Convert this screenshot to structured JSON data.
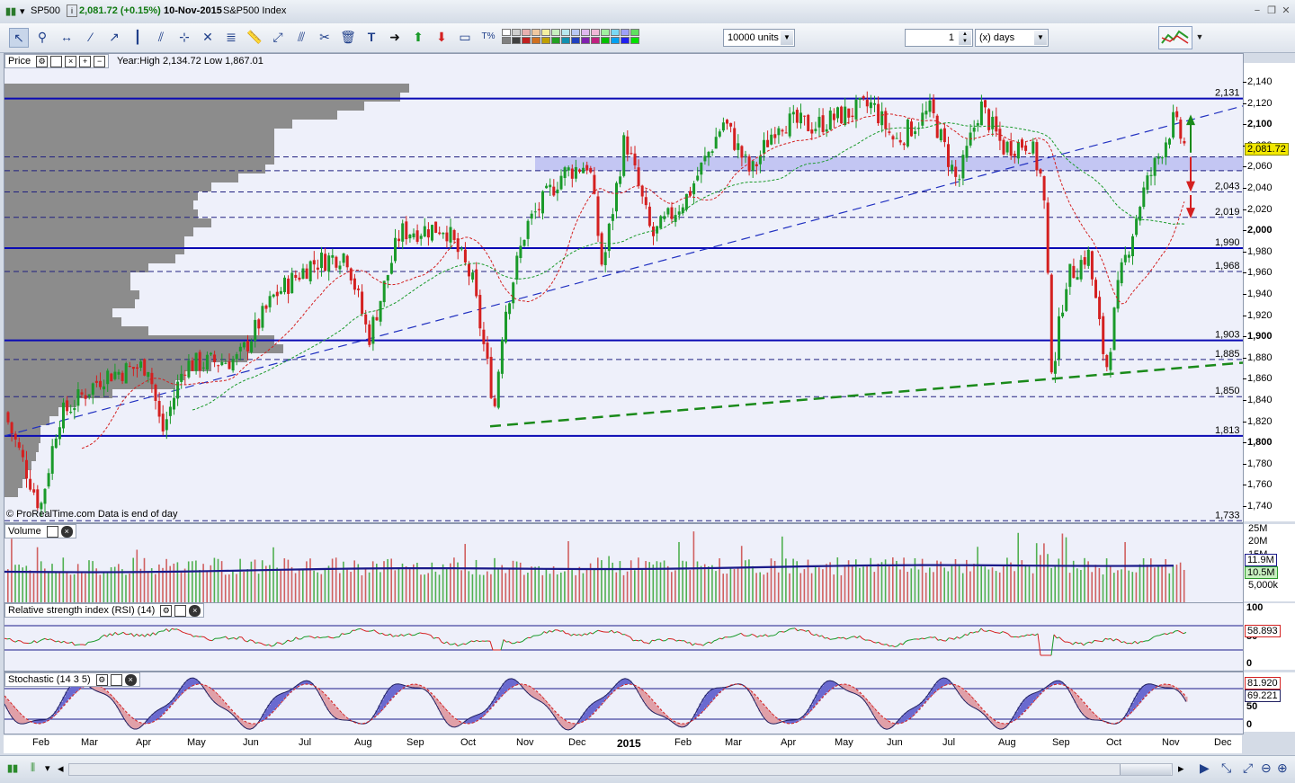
{
  "window": {
    "symbol": "SP500",
    "price_change": "2,081.72 (+0.15%)",
    "date": "10-Nov-2015",
    "name": "S&P500 Index"
  },
  "toolbar": {
    "units": "10000 units",
    "period_value": "1",
    "period_unit": "(x) days",
    "icons": [
      "pointer-icon",
      "zoom-icon",
      "horizontal-line-icon",
      "trendline-icon",
      "ray-icon",
      "vertical-line-icon",
      "channel-icon",
      "crosshair-icon",
      "fan-icon",
      "fibonacci-icon",
      "ruler-icon",
      "arrows-icon",
      "parallel-icon",
      "tools-icon",
      "trash-icon",
      "text-icon",
      "arrow-right-icon",
      "arrow-up-icon",
      "arrow-down-icon",
      "rectangle-icon",
      "percent-icon"
    ]
  },
  "price_panel": {
    "title": "Price",
    "info": "Year:High 2,134.72 Low 1,867.01",
    "footer": "© ProRealTime.com  Data is end of day",
    "last_price": "2,081.72",
    "y_ticks": [
      "2,140",
      "2,120",
      "2,100",
      "2,080",
      "2,060",
      "2,040",
      "2,020",
      "2,000",
      "1,980",
      "1,960",
      "1,940",
      "1,920",
      "1,900",
      "1,880",
      "1,860",
      "1,840",
      "1,820",
      "1,800",
      "1,780",
      "1,760",
      "1,740"
    ],
    "level_labels": [
      "2,131",
      "2,043",
      "2,019",
      "1,990",
      "1,968",
      "1,903",
      "1,885",
      "1,850",
      "1,813",
      "1,733"
    ]
  },
  "volume_panel": {
    "title": "Volume",
    "y_ticks": [
      "25M",
      "20M",
      "15M",
      "10M",
      "5,000k"
    ],
    "value_avg": "11.9M",
    "value_last": "10.5M"
  },
  "rsi_panel": {
    "title": "Relative strength index (RSI) (14)",
    "y_ticks": [
      "100",
      "50",
      "0"
    ],
    "value": "58.893"
  },
  "stoch_panel": {
    "title": "Stochastic (14 3 5)",
    "y_ticks": [
      "50",
      "0"
    ],
    "value_k": "81.920",
    "value_d": "69.221"
  },
  "x_axis": [
    "Feb",
    "Mar",
    "Apr",
    "May",
    "Jun",
    "Jul",
    "Aug",
    "Sep",
    "Oct",
    "Nov",
    "Dec",
    "2015",
    "Feb",
    "Mar",
    "Apr",
    "May",
    "Jun",
    "Jul",
    "Aug",
    "Sep",
    "Oct",
    "Nov",
    "Dec"
  ],
  "colors": {
    "up": "#1a9a2a",
    "down": "#d42020",
    "level_line": "#0a0ab4",
    "profile": "#8c8c8c",
    "band": "#b4b8f0",
    "panel_bg": "#eef0fa"
  }
}
